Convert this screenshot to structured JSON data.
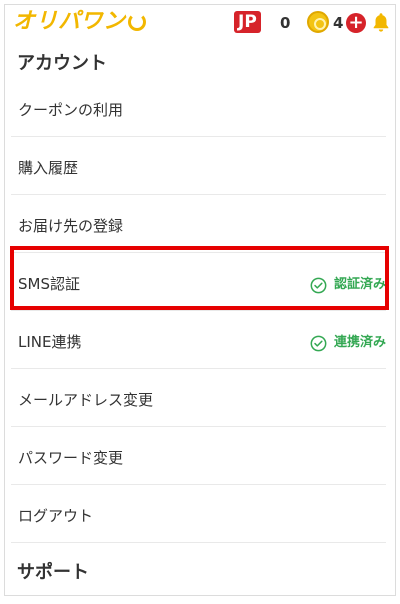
{
  "header": {
    "logo_text": "オリパワン",
    "region_badge": "JP",
    "jp_count": "0",
    "coin_count": "4",
    "icons": {
      "coin": "coin-icon",
      "add": "plus-icon",
      "notifications": "bell-icon"
    },
    "colors": {
      "brand": "#f2b700",
      "red": "#d6232a",
      "success": "#34a853"
    }
  },
  "account": {
    "title": "アカウント",
    "items": [
      {
        "label": "クーポンの利用"
      },
      {
        "label": "購入履歴"
      },
      {
        "label": "お届け先の登録"
      },
      {
        "label": "SMS認証",
        "status": "認証済み"
      },
      {
        "label": "LINE連携",
        "status": "連携済み"
      },
      {
        "label": "メールアドレス変更"
      },
      {
        "label": "パスワード変更"
      },
      {
        "label": "ログアウト"
      }
    ]
  },
  "support": {
    "title": "サポート"
  }
}
